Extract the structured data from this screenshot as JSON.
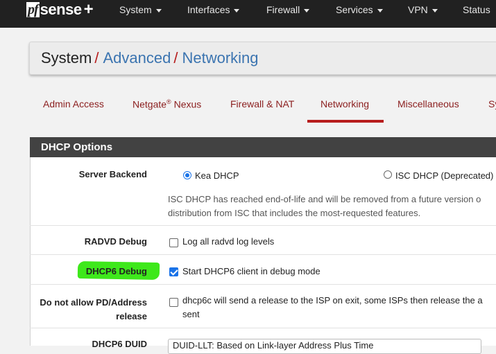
{
  "navbar": {
    "brand": {
      "pf": "pf",
      "sense": "sense",
      "plus": "+"
    },
    "items": [
      "System",
      "Interfaces",
      "Firewall",
      "Services",
      "VPN",
      "Status"
    ]
  },
  "breadcrumb": {
    "root": "System",
    "sep": "/",
    "mid": "Advanced",
    "current": "Networking"
  },
  "tabs": {
    "admin": "Admin Access",
    "nexus": "Netgate",
    "nexus_mark": "®",
    "nexus_suffix": " Nexus",
    "fwnat": "Firewall & NAT",
    "networking": "Networking",
    "misc": "Miscellaneous",
    "sys": "Sy"
  },
  "panel": {
    "title": "DHCP Options"
  },
  "server_backend": {
    "label": "Server Backend",
    "opt_kea": "Kea DHCP",
    "opt_isc": "ISC DHCP (Deprecated)",
    "selected": "Kea DHCP",
    "help_line1": "ISC DHCP has reached end-of-life and will be removed from a future version o",
    "help_line2": "distribution from ISC that includes the most-requested features."
  },
  "radvd_debug": {
    "label": "RADVD Debug",
    "text": "Log all radvd log levels",
    "checked": false
  },
  "dhcp6_debug": {
    "label": "DHCP6 Debug",
    "text": "Start DHCP6 client in debug mode",
    "checked": true,
    "highlight_color": "#3ee81b"
  },
  "no_pd_release": {
    "label_line1": "Do not allow PD/Address",
    "label_line2": "release",
    "text_line1": "dhcp6c will send a release to the ISP on exit, some ISPs then release the a",
    "text_line2": "sent",
    "checked": false
  },
  "dhcp6_duid": {
    "label": "DHCP6 DUID",
    "value": "DUID-LLT: Based on Link-layer Address Plus Time"
  },
  "colors": {
    "accent": "#b71c1c",
    "link": "#3b74b0",
    "navbar": "#212121",
    "panel_heading": "#424242"
  }
}
